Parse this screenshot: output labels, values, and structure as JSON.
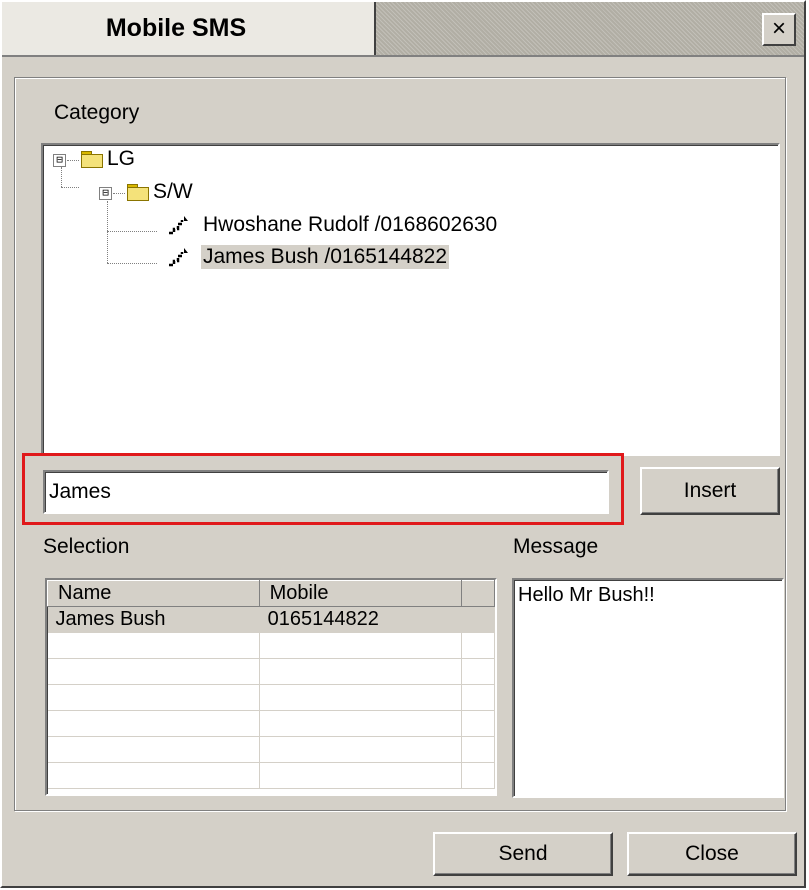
{
  "window": {
    "title": "Mobile SMS",
    "close_glyph": "×"
  },
  "category": {
    "label": "Category",
    "tree": [
      {
        "label": "LG",
        "expander": "⊟",
        "type": "folder"
      },
      {
        "label": "S/W",
        "expander": "⊟",
        "type": "folder"
      },
      {
        "label": "Hwoshane Rudolf /0168602630",
        "type": "contact"
      },
      {
        "label": "James Bush /0165144822",
        "type": "contact",
        "selected": true
      }
    ]
  },
  "search": {
    "value": "James",
    "highlight_color": "#e0191b"
  },
  "insert_button": "Insert",
  "selection": {
    "label": "Selection",
    "columns": [
      "Name",
      "Mobile"
    ],
    "rows": [
      {
        "name": "James Bush",
        "mobile": "0165144822"
      }
    ]
  },
  "message": {
    "label": "Message",
    "value": "Hello Mr Bush!!"
  },
  "footer": {
    "send": "Send",
    "close": "Close"
  }
}
